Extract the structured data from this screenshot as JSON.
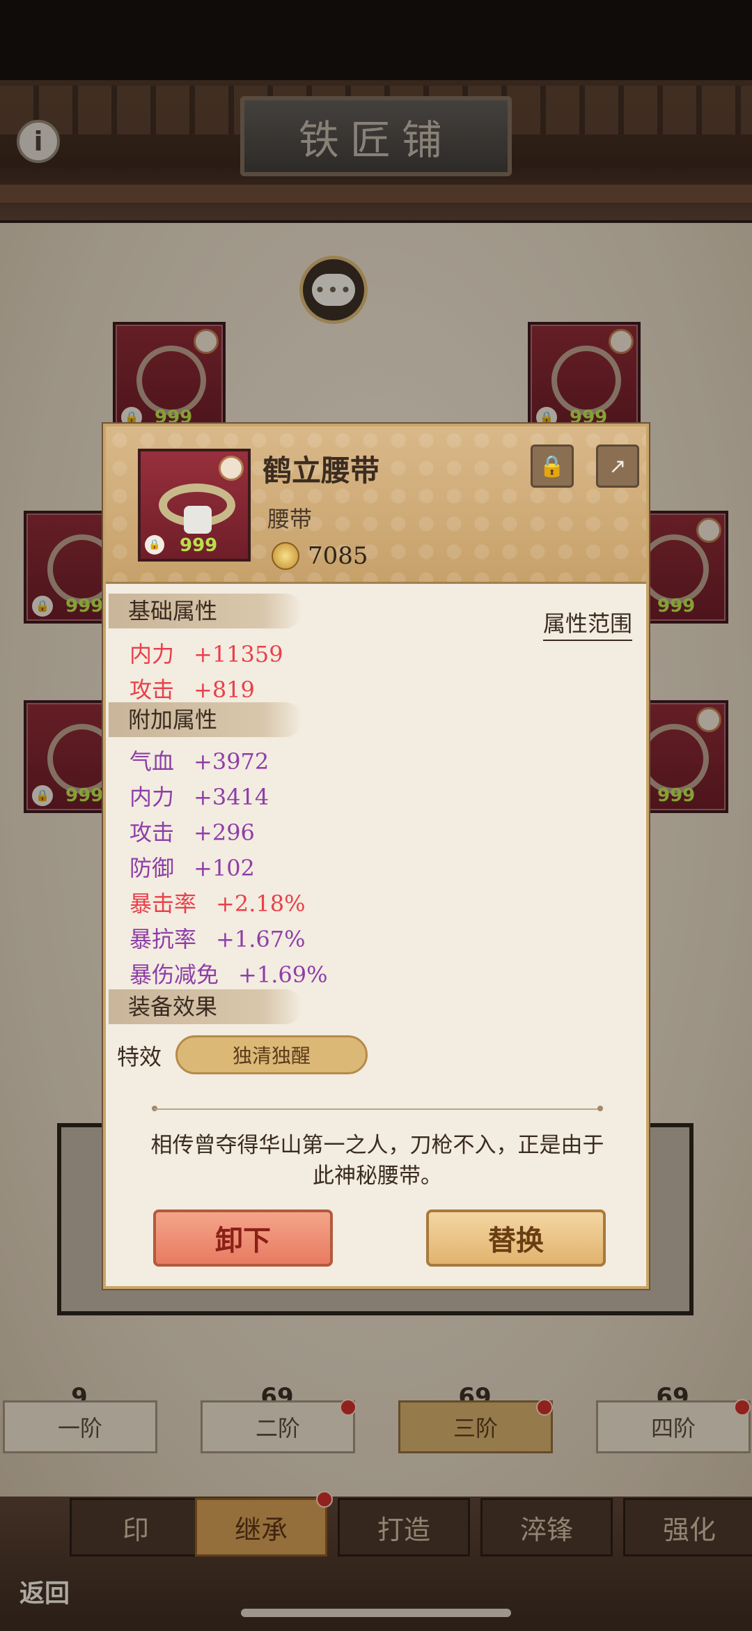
{
  "screen": {
    "title": "铁匠铺",
    "info_label": "i"
  },
  "chat": {
    "icon": "chat-bubble-icon",
    "dots": "•••"
  },
  "slots": [
    {
      "id": "weapon",
      "level": "999"
    },
    {
      "id": "necklace",
      "level": "999"
    },
    {
      "id": "armor",
      "level": "999"
    },
    {
      "id": "spear",
      "level": "999"
    },
    {
      "id": "belt",
      "level": "999"
    },
    {
      "id": "bracelet",
      "level": "999"
    }
  ],
  "stages": [
    {
      "glyph": "9",
      "label": "一阶",
      "has_dot": false
    },
    {
      "glyph": "69",
      "label": "二阶",
      "has_dot": true
    },
    {
      "glyph": "69",
      "label": "三阶",
      "has_dot": true
    },
    {
      "glyph": "69",
      "label": "四阶",
      "has_dot": true
    }
  ],
  "menu_tabs": [
    {
      "label": "印"
    },
    {
      "label": "继承"
    },
    {
      "label": "打造"
    },
    {
      "label": "淬锋"
    },
    {
      "label": "强化"
    }
  ],
  "back_label": "返回",
  "popup": {
    "item_name": "鹤立腰带",
    "item_type": "腰带",
    "item_level": "999",
    "power": "7085",
    "lock_icon": "lock-icon",
    "share_icon": "share-icon",
    "range_link": "属性范围",
    "base_section": "基础属性",
    "base_stats": [
      {
        "name": "内力",
        "value": "+11359"
      },
      {
        "name": "攻击",
        "value": "+819"
      }
    ],
    "extra_section": "附加属性",
    "extra_stats": [
      {
        "name": "气血",
        "value": "+3972"
      },
      {
        "name": "内力",
        "value": "+3414"
      },
      {
        "name": "攻击",
        "value": "+296"
      },
      {
        "name": "防御",
        "value": "+102"
      },
      {
        "name": "暴击率",
        "value": "+2.18%"
      },
      {
        "name": "暴抗率",
        "value": "+1.67%"
      },
      {
        "name": "暴伤减免",
        "value": "+1.69%"
      }
    ],
    "effect_section": "装备效果",
    "effect_label": "特效",
    "effect_name": "独清独醒",
    "description": "相传曾夺得华山第一之人，刀枪不入，正是由于此神秘腰带。",
    "unequip_label": "卸下",
    "replace_label": "替换"
  },
  "colors": {
    "stat_red": "#e8404a",
    "stat_purple": "#8e3ea8",
    "slot_red": "#8c2a34",
    "gold": "#cfa96a"
  }
}
